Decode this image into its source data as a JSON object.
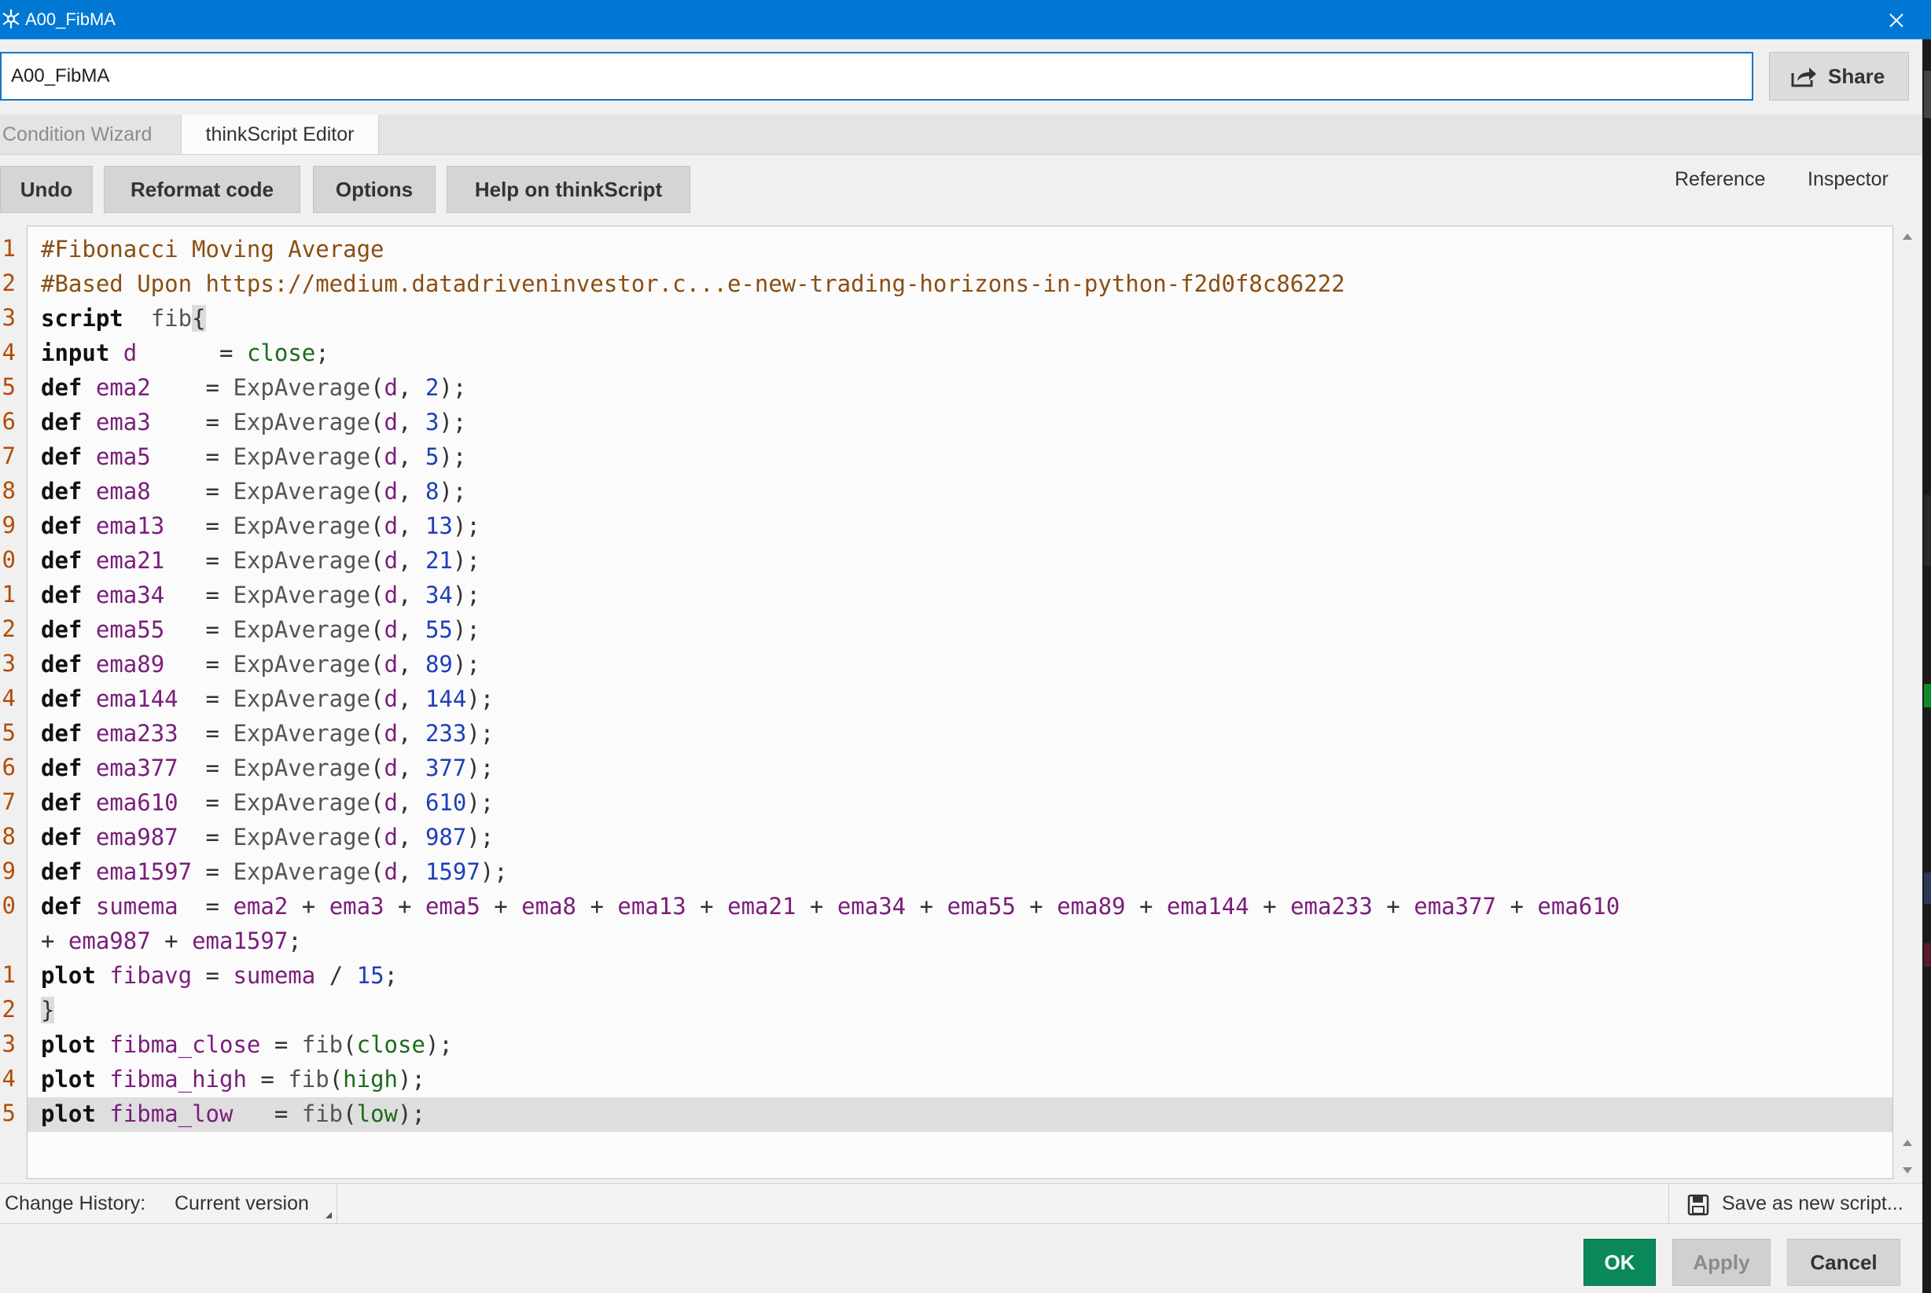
{
  "window": {
    "title": "A00_FibMA",
    "close": "✕"
  },
  "name_field": {
    "value": "A00_FibMA"
  },
  "share_button": "Share",
  "tabs": [
    "Condition Wizard",
    "thinkScript Editor"
  ],
  "toolbar": {
    "buttons": [
      "Undo",
      "Reformat code",
      "Options",
      "Help on thinkScript"
    ],
    "links": [
      "Reference",
      "Inspector"
    ]
  },
  "gutter_numbers": [
    "1",
    "2",
    "3",
    "4",
    "5",
    "6",
    "7",
    "8",
    "9",
    "0",
    "1",
    "2",
    "3",
    "4",
    "5",
    "6",
    "7",
    "8",
    "9",
    "0",
    "",
    "1",
    "2",
    "3",
    "4",
    "5"
  ],
  "code": [
    [
      [
        "cm",
        "#Fibonacci Moving Average"
      ]
    ],
    [
      [
        "cm",
        "#Based Upon https://medium.datadriveninvestor.c...e-new-trading-horizons-in-python-f2d0f8c86222"
      ]
    ],
    [
      [
        "kw",
        "script"
      ],
      [
        "",
        "  "
      ],
      [
        "fn",
        "fib"
      ],
      [
        "bk",
        "{"
      ]
    ],
    [
      [
        "kw",
        "input"
      ],
      [
        "",
        " "
      ],
      [
        "vr",
        "d"
      ],
      [
        "",
        "      = "
      ],
      [
        "cl",
        "close"
      ],
      [
        "",
        ";"
      ]
    ],
    [
      [
        "kw",
        "def"
      ],
      [
        "",
        " "
      ],
      [
        "vr",
        "ema2"
      ],
      [
        "",
        "    = "
      ],
      [
        "fn",
        "ExpAverage"
      ],
      [
        "",
        "("
      ],
      [
        "vr",
        "d"
      ],
      [
        "",
        ", "
      ],
      [
        "nm",
        "2"
      ],
      [
        "",
        ");"
      ]
    ],
    [
      [
        "kw",
        "def"
      ],
      [
        "",
        " "
      ],
      [
        "vr",
        "ema3"
      ],
      [
        "",
        "    = "
      ],
      [
        "fn",
        "ExpAverage"
      ],
      [
        "",
        "("
      ],
      [
        "vr",
        "d"
      ],
      [
        "",
        ", "
      ],
      [
        "nm",
        "3"
      ],
      [
        "",
        ");"
      ]
    ],
    [
      [
        "kw",
        "def"
      ],
      [
        "",
        " "
      ],
      [
        "vr",
        "ema5"
      ],
      [
        "",
        "    = "
      ],
      [
        "fn",
        "ExpAverage"
      ],
      [
        "",
        "("
      ],
      [
        "vr",
        "d"
      ],
      [
        "",
        ", "
      ],
      [
        "nm",
        "5"
      ],
      [
        "",
        ");"
      ]
    ],
    [
      [
        "kw",
        "def"
      ],
      [
        "",
        " "
      ],
      [
        "vr",
        "ema8"
      ],
      [
        "",
        "    = "
      ],
      [
        "fn",
        "ExpAverage"
      ],
      [
        "",
        "("
      ],
      [
        "vr",
        "d"
      ],
      [
        "",
        ", "
      ],
      [
        "nm",
        "8"
      ],
      [
        "",
        ");"
      ]
    ],
    [
      [
        "kw",
        "def"
      ],
      [
        "",
        " "
      ],
      [
        "vr",
        "ema13"
      ],
      [
        "",
        "   = "
      ],
      [
        "fn",
        "ExpAverage"
      ],
      [
        "",
        "("
      ],
      [
        "vr",
        "d"
      ],
      [
        "",
        ", "
      ],
      [
        "nm",
        "13"
      ],
      [
        "",
        ");"
      ]
    ],
    [
      [
        "kw",
        "def"
      ],
      [
        "",
        " "
      ],
      [
        "vr",
        "ema21"
      ],
      [
        "",
        "   = "
      ],
      [
        "fn",
        "ExpAverage"
      ],
      [
        "",
        "("
      ],
      [
        "vr",
        "d"
      ],
      [
        "",
        ", "
      ],
      [
        "nm",
        "21"
      ],
      [
        "",
        ");"
      ]
    ],
    [
      [
        "kw",
        "def"
      ],
      [
        "",
        " "
      ],
      [
        "vr",
        "ema34"
      ],
      [
        "",
        "   = "
      ],
      [
        "fn",
        "ExpAverage"
      ],
      [
        "",
        "("
      ],
      [
        "vr",
        "d"
      ],
      [
        "",
        ", "
      ],
      [
        "nm",
        "34"
      ],
      [
        "",
        ");"
      ]
    ],
    [
      [
        "kw",
        "def"
      ],
      [
        "",
        " "
      ],
      [
        "vr",
        "ema55"
      ],
      [
        "",
        "   = "
      ],
      [
        "fn",
        "ExpAverage"
      ],
      [
        "",
        "("
      ],
      [
        "vr",
        "d"
      ],
      [
        "",
        ", "
      ],
      [
        "nm",
        "55"
      ],
      [
        "",
        ");"
      ]
    ],
    [
      [
        "kw",
        "def"
      ],
      [
        "",
        " "
      ],
      [
        "vr",
        "ema89"
      ],
      [
        "",
        "   = "
      ],
      [
        "fn",
        "ExpAverage"
      ],
      [
        "",
        "("
      ],
      [
        "vr",
        "d"
      ],
      [
        "",
        ", "
      ],
      [
        "nm",
        "89"
      ],
      [
        "",
        ");"
      ]
    ],
    [
      [
        "kw",
        "def"
      ],
      [
        "",
        " "
      ],
      [
        "vr",
        "ema144"
      ],
      [
        "",
        "  = "
      ],
      [
        "fn",
        "ExpAverage"
      ],
      [
        "",
        "("
      ],
      [
        "vr",
        "d"
      ],
      [
        "",
        ", "
      ],
      [
        "nm",
        "144"
      ],
      [
        "",
        ");"
      ]
    ],
    [
      [
        "kw",
        "def"
      ],
      [
        "",
        " "
      ],
      [
        "vr",
        "ema233"
      ],
      [
        "",
        "  = "
      ],
      [
        "fn",
        "ExpAverage"
      ],
      [
        "",
        "("
      ],
      [
        "vr",
        "d"
      ],
      [
        "",
        ", "
      ],
      [
        "nm",
        "233"
      ],
      [
        "",
        ");"
      ]
    ],
    [
      [
        "kw",
        "def"
      ],
      [
        "",
        " "
      ],
      [
        "vr",
        "ema377"
      ],
      [
        "",
        "  = "
      ],
      [
        "fn",
        "ExpAverage"
      ],
      [
        "",
        "("
      ],
      [
        "vr",
        "d"
      ],
      [
        "",
        ", "
      ],
      [
        "nm",
        "377"
      ],
      [
        "",
        ");"
      ]
    ],
    [
      [
        "kw",
        "def"
      ],
      [
        "",
        " "
      ],
      [
        "vr",
        "ema610"
      ],
      [
        "",
        "  = "
      ],
      [
        "fn",
        "ExpAverage"
      ],
      [
        "",
        "("
      ],
      [
        "vr",
        "d"
      ],
      [
        "",
        ", "
      ],
      [
        "nm",
        "610"
      ],
      [
        "",
        ");"
      ]
    ],
    [
      [
        "kw",
        "def"
      ],
      [
        "",
        " "
      ],
      [
        "vr",
        "ema987"
      ],
      [
        "",
        "  = "
      ],
      [
        "fn",
        "ExpAverage"
      ],
      [
        "",
        "("
      ],
      [
        "vr",
        "d"
      ],
      [
        "",
        ", "
      ],
      [
        "nm",
        "987"
      ],
      [
        "",
        ");"
      ]
    ],
    [
      [
        "kw",
        "def"
      ],
      [
        "",
        " "
      ],
      [
        "vr",
        "ema1597"
      ],
      [
        "",
        " = "
      ],
      [
        "fn",
        "ExpAverage"
      ],
      [
        "",
        "("
      ],
      [
        "vr",
        "d"
      ],
      [
        "",
        ", "
      ],
      [
        "nm",
        "1597"
      ],
      [
        "",
        ");"
      ]
    ],
    [
      [
        "kw",
        "def"
      ],
      [
        "",
        " "
      ],
      [
        "vr",
        "sumema"
      ],
      [
        "",
        "  = "
      ],
      [
        "vr",
        "ema2"
      ],
      [
        "",
        " + "
      ],
      [
        "vr",
        "ema3"
      ],
      [
        "",
        " + "
      ],
      [
        "vr",
        "ema5"
      ],
      [
        "",
        " + "
      ],
      [
        "vr",
        "ema8"
      ],
      [
        "",
        " + "
      ],
      [
        "vr",
        "ema13"
      ],
      [
        "",
        " + "
      ],
      [
        "vr",
        "ema21"
      ],
      [
        "",
        " + "
      ],
      [
        "vr",
        "ema34"
      ],
      [
        "",
        " + "
      ],
      [
        "vr",
        "ema55"
      ],
      [
        "",
        " + "
      ],
      [
        "vr",
        "ema89"
      ],
      [
        "",
        " + "
      ],
      [
        "vr",
        "ema144"
      ],
      [
        "",
        " + "
      ],
      [
        "vr",
        "ema233"
      ],
      [
        "",
        " + "
      ],
      [
        "vr",
        "ema377"
      ],
      [
        "",
        " + "
      ],
      [
        "vr",
        "ema610"
      ]
    ],
    [
      [
        "",
        "+ "
      ],
      [
        "vr",
        "ema987"
      ],
      [
        "",
        " + "
      ],
      [
        "vr",
        "ema1597"
      ],
      [
        "",
        ";"
      ]
    ],
    [
      [
        "kw",
        "plot"
      ],
      [
        "",
        " "
      ],
      [
        "vr",
        "fibavg"
      ],
      [
        "",
        " = "
      ],
      [
        "vr",
        "sumema"
      ],
      [
        "",
        " / "
      ],
      [
        "nm",
        "15"
      ],
      [
        "",
        ";"
      ]
    ],
    [
      [
        "bk",
        "}"
      ]
    ],
    [
      [
        "kw",
        "plot"
      ],
      [
        "",
        " "
      ],
      [
        "vr",
        "fibma_close"
      ],
      [
        "",
        " = "
      ],
      [
        "fn",
        "fib"
      ],
      [
        "",
        "("
      ],
      [
        "cl",
        "close"
      ],
      [
        "",
        ");"
      ]
    ],
    [
      [
        "kw",
        "plot"
      ],
      [
        "",
        " "
      ],
      [
        "vr",
        "fibma_high"
      ],
      [
        "",
        " ",
        " "
      ],
      [
        "",
        "= "
      ],
      [
        "fn",
        "fib"
      ],
      [
        "",
        "("
      ],
      [
        "cl",
        "high"
      ],
      [
        "",
        ");"
      ]
    ],
    [
      [
        "kw",
        "plot"
      ],
      [
        "",
        " "
      ],
      [
        "vr",
        "fibma_low"
      ],
      [
        "",
        "   = "
      ],
      [
        "fn",
        "fib"
      ],
      [
        "",
        "("
      ],
      [
        "cl",
        "low"
      ],
      [
        "",
        ");"
      ]
    ]
  ],
  "status_bar": {
    "label": "Change History:",
    "version": "Current version",
    "save": "Save as new script..."
  },
  "footer": {
    "ok": "OK",
    "apply": "Apply",
    "cancel": "Cancel"
  },
  "colors": {
    "titlebar": "#0078d4",
    "ok_button": "#0a8a5a",
    "line_number": "#b34c00",
    "comment": "#8a4f13",
    "variable": "#7a1e7a",
    "number": "#1f3fb8",
    "constant": "#1b6b1b"
  }
}
